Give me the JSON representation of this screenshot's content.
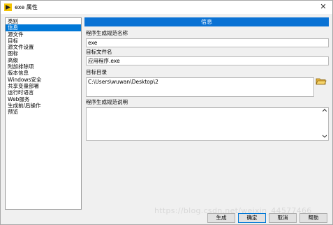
{
  "titlebar": {
    "title": "exe 属性",
    "close_glyph": "✕"
  },
  "sidebar": {
    "header": "类别",
    "items": [
      {
        "label": "信息",
        "selected": true
      },
      {
        "label": "源文件"
      },
      {
        "label": "目标"
      },
      {
        "label": "源文件设置"
      },
      {
        "label": "图标"
      },
      {
        "label": "高级"
      },
      {
        "label": "附加排除项"
      },
      {
        "label": "版本信息"
      },
      {
        "label": "Windows安全"
      },
      {
        "label": "共享变量部署"
      },
      {
        "label": "运行时语言"
      },
      {
        "label": "Web服务"
      },
      {
        "label": "生成前/后操作"
      },
      {
        "label": "预览"
      }
    ]
  },
  "main": {
    "section_title": "信息",
    "spec_name_label": "程序生成规范名称",
    "spec_name_value": "exe",
    "target_file_label": "目标文件名",
    "target_file_value": "应用程序.exe",
    "target_dir_label": "目标目录",
    "target_dir_value": "C:\\Users\\wuwan\\Desktop\\2",
    "description_label": "程序生成规范说明",
    "description_value": ""
  },
  "buttons": {
    "build": "生成",
    "ok": "确定",
    "cancel": "取消",
    "help": "帮助"
  },
  "watermark": "https://blog.csdn.net/weixin_44577466",
  "colors": {
    "accent": "#0078d7",
    "header_bar": "#0a72d4"
  }
}
